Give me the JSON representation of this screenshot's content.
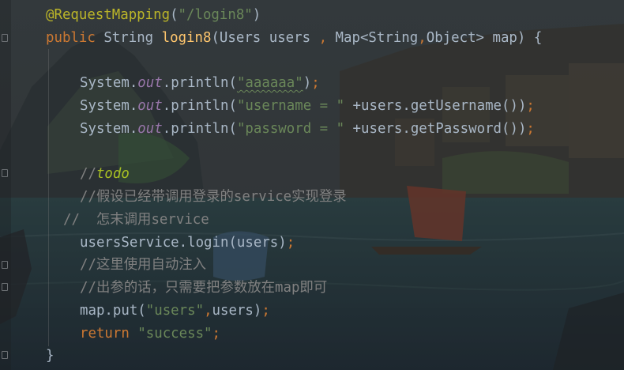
{
  "code": {
    "line1": {
      "annotation": "@RequestMapping",
      "paren_open": "(",
      "path": "\"/login8\"",
      "paren_close": ")"
    },
    "line2": {
      "kw_public": "public",
      "type": "String",
      "method": "login8",
      "params": "(Users users ",
      "comma": ",",
      "params2": " Map<String",
      "comma2": ",",
      "params3": "Object> map) {"
    },
    "line3": {
      "prefix": "System.",
      "field": "out",
      "call": ".println(",
      "str": "\"aaaaaa\"",
      "end": ")",
      "semi": ";"
    },
    "line4": {
      "prefix": "System.",
      "field": "out",
      "call": ".println(",
      "str": "\"username = \"",
      "rest": " +users.getUsername())",
      "semi": ";"
    },
    "line5": {
      "prefix": "System.",
      "field": "out",
      "call": ".println(",
      "str": "\"password = \"",
      "rest": " +users.getPassword())",
      "semi": ";"
    },
    "line6": {
      "comment_slashes": "//",
      "todo": "todo"
    },
    "line7": {
      "comment": "//假设已经带调用登录的service实现登录"
    },
    "line8": {
      "comment": "//  怎末调用service"
    },
    "line9": {
      "text": "usersService.login(users)",
      "semi": ";"
    },
    "line10": {
      "comment": "//这里使用自动注入"
    },
    "line11": {
      "comment": "//出参的话，只需要把参数放在map即可"
    },
    "line12": {
      "prefix": "map.put(",
      "str": "\"users\"",
      "comma": ",",
      "rest": "users)",
      "semi": ";"
    },
    "line13": {
      "kw": "return",
      "str": " \"success\"",
      "semi": ";"
    },
    "line14": {
      "brace": "}"
    }
  },
  "colors": {
    "annotation": "#bbb529",
    "keyword": "#cc7832",
    "string": "#6a8759",
    "method": "#ffc66d",
    "field": "#9876aa",
    "comment": "#808080",
    "todo": "#a8c023",
    "plain": "#a9b7c6"
  }
}
